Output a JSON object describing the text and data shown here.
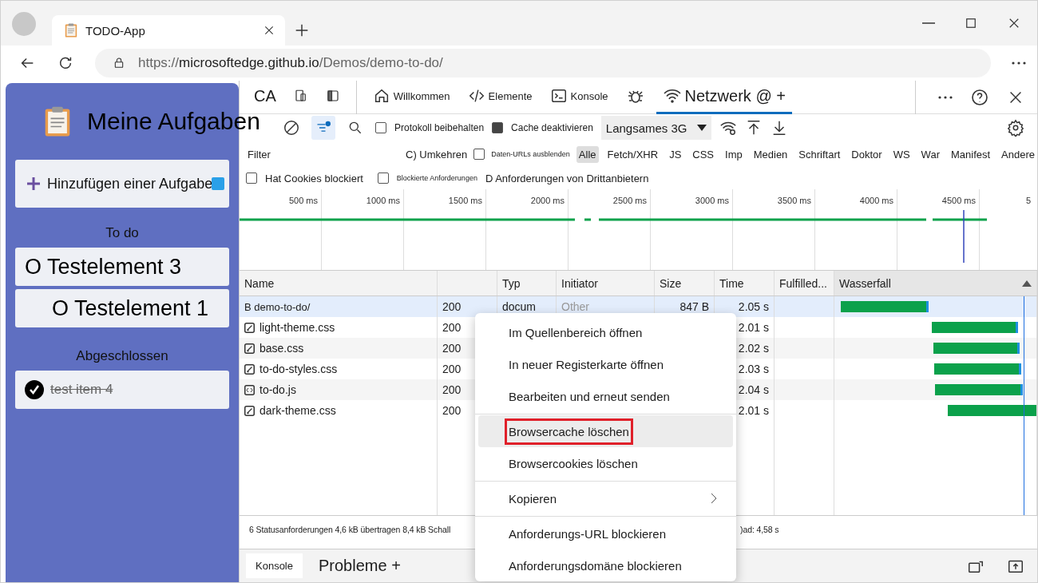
{
  "browser": {
    "tab_title": "TODO-App",
    "url": {
      "scheme": "https://",
      "host": "microsoftedge.github.io",
      "path": "/Demos/demo-to-do/"
    }
  },
  "app": {
    "title": "Meine Aufgaben",
    "add_label": "Hinzufügen einer Aufgabe",
    "todo_heading": "To do",
    "done_heading": "Abgeschlossen",
    "tasks": [
      {
        "label": "O Testelement 3",
        "done": false
      },
      {
        "label": "O Testelement 1",
        "done": false
      }
    ],
    "completed": [
      {
        "label": "test item 4",
        "done": true
      }
    ]
  },
  "devtools": {
    "tabs": [
      {
        "kind": "text",
        "label": "CA",
        "selected": false
      },
      {
        "kind": "device",
        "selected": false
      },
      {
        "kind": "dock",
        "selected": false
      },
      {
        "kind": "home",
        "label": "Willkommen",
        "selected": false
      },
      {
        "kind": "code",
        "label": "Elemente",
        "selected": false
      },
      {
        "kind": "console",
        "label": "Konsole",
        "selected": false
      },
      {
        "kind": "bug",
        "selected": false
      },
      {
        "kind": "wifi",
        "label": "Netzwerk @ +",
        "selected": true
      }
    ],
    "toolbar": {
      "preserve_log": {
        "label": "Protokoll beibehalten",
        "checked": false
      },
      "disable_cache": {
        "label": "Cache deaktivieren",
        "checked": true
      },
      "throttling": "Langsames 3G",
      "filter_active": true
    },
    "filter": {
      "placeholder": "Filter",
      "invert": "C) Umkehren",
      "hide_data_urls": {
        "label": "Daten-URLs ausblenden",
        "checked": false
      },
      "types": [
        {
          "label": "Alle",
          "selected": true
        },
        {
          "label": "Fetch/XHR",
          "selected": false
        },
        {
          "label": "JS",
          "selected": false
        },
        {
          "label": "CSS",
          "selected": false
        },
        {
          "label": "Imp",
          "selected": false
        },
        {
          "label": "Medien",
          "selected": false
        },
        {
          "label": "Schriftart",
          "selected": false
        },
        {
          "label": "Doktor",
          "selected": false
        },
        {
          "label": "WS",
          "selected": false
        },
        {
          "label": "War",
          "selected": false
        },
        {
          "label": "Manifest",
          "selected": false
        },
        {
          "label": "Andere",
          "selected": false
        }
      ]
    },
    "options": {
      "blocked_cookies": {
        "label": "Hat Cookies blockiert",
        "checked": false
      },
      "blocked_requests": {
        "label": "Blockierte Anforderungen",
        "checked": false
      },
      "third_party": "D Anforderungen von Drittanbietern"
    },
    "ticks": [
      "500 ms",
      "1000 ms",
      "1500 ms",
      "2000 ms",
      "2500 ms",
      "3000 ms",
      "3500 ms",
      "4000 ms",
      "4500 ms",
      "5"
    ],
    "columns": [
      "Name",
      "Typ",
      "Initiator",
      "Size",
      "Time",
      "Fulfilled...",
      "Wasserfall"
    ],
    "rows": [
      {
        "kind": "document",
        "name": "B demo-to-do/",
        "status": "200",
        "type": "docum",
        "initiator": "Other",
        "size": "847 B",
        "time": "2.05 s",
        "selected": true
      },
      {
        "kind": "css",
        "name": "light-theme.css",
        "status": "200",
        "time": "2.01 s",
        "selected": false
      },
      {
        "kind": "css",
        "name": "base.css",
        "status": "200",
        "time": "2.02 s",
        "selected": false
      },
      {
        "kind": "css",
        "name": "to-do-styles.css",
        "status": "200",
        "time": "2.03 s",
        "selected": false
      },
      {
        "kind": "script",
        "name": "to-do.js",
        "status": "200",
        "time": "2.04 s",
        "selected": false
      },
      {
        "kind": "css",
        "name": "dark-theme.css",
        "status": "200",
        "time": "2.01 s",
        "selected": false
      }
    ],
    "status": {
      "left": "6 Statusanforderungen 4,6 kB übertragen 8,4 kB Schall",
      "right": ")ad: 4,58 s"
    },
    "drawer": [
      {
        "label": "Konsole",
        "selected": true
      },
      {
        "label": "Probleme +",
        "selected": false
      }
    ]
  },
  "context_menu": [
    [
      {
        "label": "Im Quellenbereich öffnen",
        "selected": false,
        "annotated": false
      },
      {
        "label": "In neuer Registerkarte öffnen",
        "selected": false,
        "annotated": false
      },
      {
        "label": "Bearbeiten und erneut senden",
        "selected": false,
        "annotated": false
      }
    ],
    [
      {
        "label": "Browsercache löschen",
        "selected": true,
        "annotated": true
      },
      {
        "label": "Browsercookies löschen",
        "selected": false,
        "annotated": false
      }
    ],
    [
      {
        "label": "Kopieren",
        "selected": false,
        "annotated": false,
        "submenu": true
      }
    ],
    [
      {
        "label": "Anforderungs-URL blockieren",
        "selected": false,
        "annotated": false
      },
      {
        "label": "Anforderungsdomäne blockieren",
        "selected": false,
        "annotated": false
      }
    ]
  ]
}
